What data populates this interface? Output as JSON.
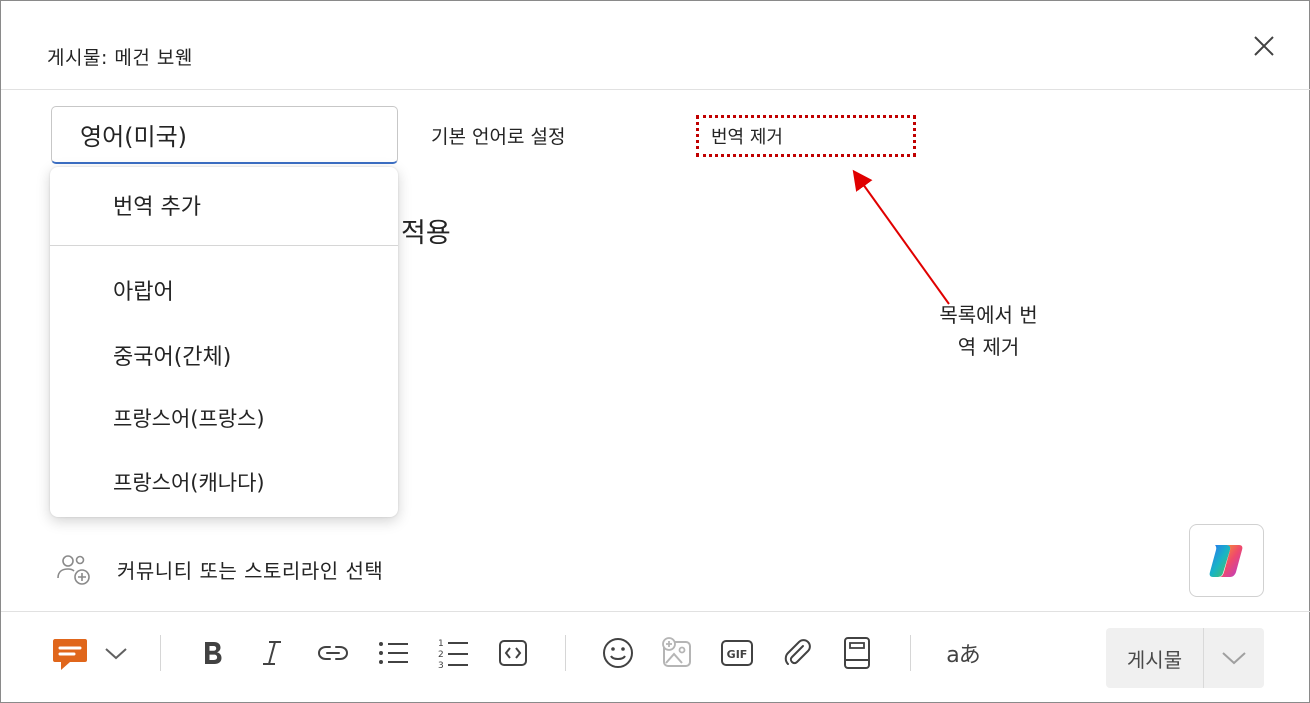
{
  "header": {
    "title": "게시물: 메건 보웬"
  },
  "language_select": {
    "value": "영어(미국)"
  },
  "actions": {
    "set_default": "기본 언어로 설정",
    "remove_translation": "번역 제거"
  },
  "body": {
    "apply_text": "적용"
  },
  "dropdown": {
    "add_translation": "번역 추가",
    "options": [
      "아랍어",
      "중국어(간체)",
      "프랑스어(프랑스)",
      "프랑스어(캐나다)"
    ]
  },
  "annotation": {
    "line1": "목록에서 번",
    "line2": "역 제거",
    "color": "#e00000"
  },
  "community": {
    "label": "커뮤니티 또는 스토리라인 선택"
  },
  "toolbar": {
    "icons": [
      "message-type-icon",
      "chevron-down-icon",
      "bold-icon",
      "italic-icon",
      "link-icon",
      "bullet-list-icon",
      "numbered-list-icon",
      "code-icon",
      "emoji-icon",
      "image-icon",
      "gif-icon",
      "attachment-icon",
      "book-icon",
      "translate-icon"
    ],
    "gif_text": "GIF",
    "translate_text": "aあ",
    "accent": "#e0661b"
  },
  "post_button": {
    "label": "게시물"
  }
}
